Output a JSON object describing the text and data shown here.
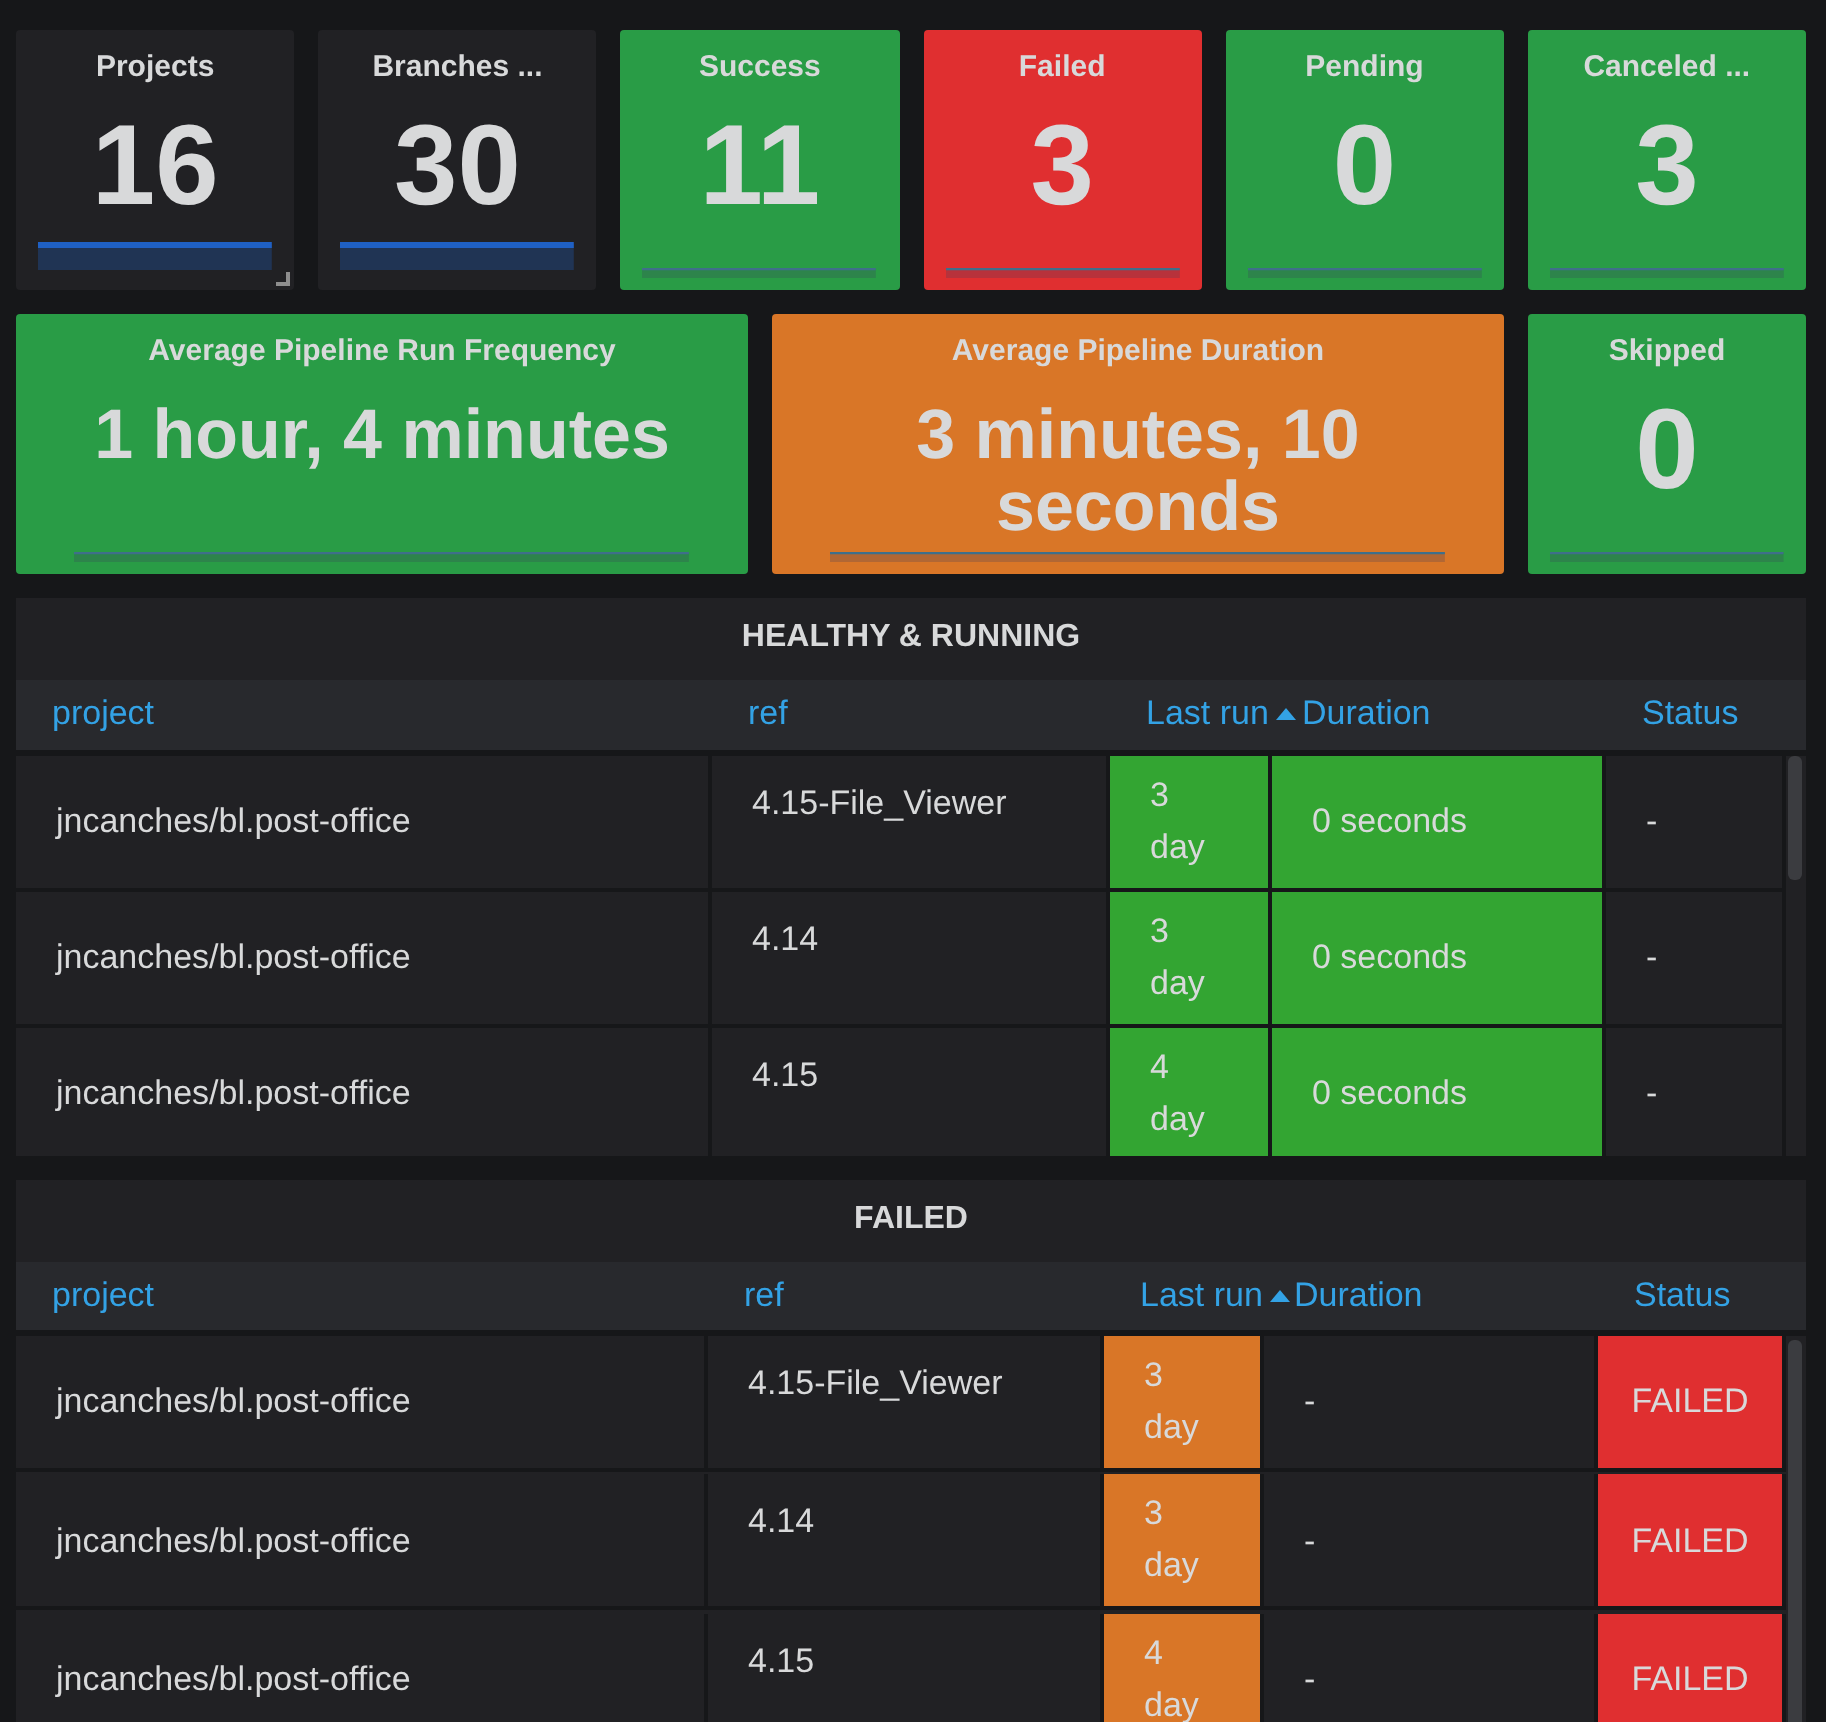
{
  "stat_rows": [
    [
      {
        "title": "Projects",
        "value": "16",
        "color": "#212124",
        "resize_handle": true
      },
      {
        "title": "Branches ...",
        "value": "30",
        "color": "#212124"
      },
      {
        "title": "Success",
        "value": "11",
        "color": "#299c46"
      },
      {
        "title": "Failed",
        "value": "3",
        "color": "#e02f30"
      },
      {
        "title": "Pending",
        "value": "0",
        "color": "#299c46"
      },
      {
        "title": "Canceled ...",
        "value": "3",
        "color": "#299c46"
      }
    ],
    [
      {
        "title": "Average Pipeline Run Frequency",
        "value": "1 hour, 4 minutes",
        "color": "#299c46"
      },
      {
        "title": "Average Pipeline Duration",
        "value": "3 minutes, 10 seconds",
        "color": "#d97627"
      },
      {
        "title": "Skipped",
        "value": "0",
        "color": "#299c46"
      }
    ]
  ],
  "tables": [
    {
      "title": "HEALTHY & RUNNING",
      "columns": [
        {
          "label": "project",
          "sorted": false
        },
        {
          "label": "ref",
          "sorted": false
        },
        {
          "label": "Last run",
          "sorted": true
        },
        {
          "label": "Duration",
          "sorted": false
        },
        {
          "label": "Status",
          "sorted": false
        }
      ],
      "rows": [
        {
          "cells": [
            {
              "text": "jncanches/bl.post-office"
            },
            {
              "text": "4.15-File_Viewer"
            },
            {
              "text": "3 day",
              "color": "#33a532"
            },
            {
              "text": "0 seconds",
              "color": "#33a532"
            },
            {
              "text": "-"
            }
          ]
        },
        {
          "cells": [
            {
              "text": "jncanches/bl.post-office"
            },
            {
              "text": "4.14"
            },
            {
              "text": "3 day",
              "color": "#33a532"
            },
            {
              "text": "0 seconds",
              "color": "#33a532"
            },
            {
              "text": "-"
            }
          ]
        },
        {
          "cells": [
            {
              "text": "jncanches/bl.post-office"
            },
            {
              "text": "4.15"
            },
            {
              "text": "4 day",
              "color": "#33a532"
            },
            {
              "text": "0 seconds",
              "color": "#33a532"
            },
            {
              "text": "-"
            }
          ]
        }
      ]
    },
    {
      "title": "FAILED",
      "columns": [
        {
          "label": "project",
          "sorted": false
        },
        {
          "label": "ref",
          "sorted": false
        },
        {
          "label": "Last run",
          "sorted": true
        },
        {
          "label": "Duration",
          "sorted": false
        },
        {
          "label": "Status",
          "sorted": false
        }
      ],
      "rows": [
        {
          "cells": [
            {
              "text": "jncanches/bl.post-office"
            },
            {
              "text": "4.15-File_Viewer"
            },
            {
              "text": "3 day",
              "color": "#d97627"
            },
            {
              "text": "-"
            },
            {
              "text": "FAILED",
              "color": "#e02f30"
            }
          ]
        },
        {
          "cells": [
            {
              "text": "jncanches/bl.post-office"
            },
            {
              "text": "4.14"
            },
            {
              "text": "3 day",
              "color": "#d97627"
            },
            {
              "text": "-"
            },
            {
              "text": "FAILED",
              "color": "#e02f30"
            }
          ]
        },
        {
          "cells": [
            {
              "text": "jncanches/bl.post-office"
            },
            {
              "text": "4.15"
            },
            {
              "text": "4 day",
              "color": "#d97627"
            },
            {
              "text": "-"
            },
            {
              "text": "FAILED",
              "color": "#e02f30"
            }
          ]
        }
      ]
    }
  ]
}
